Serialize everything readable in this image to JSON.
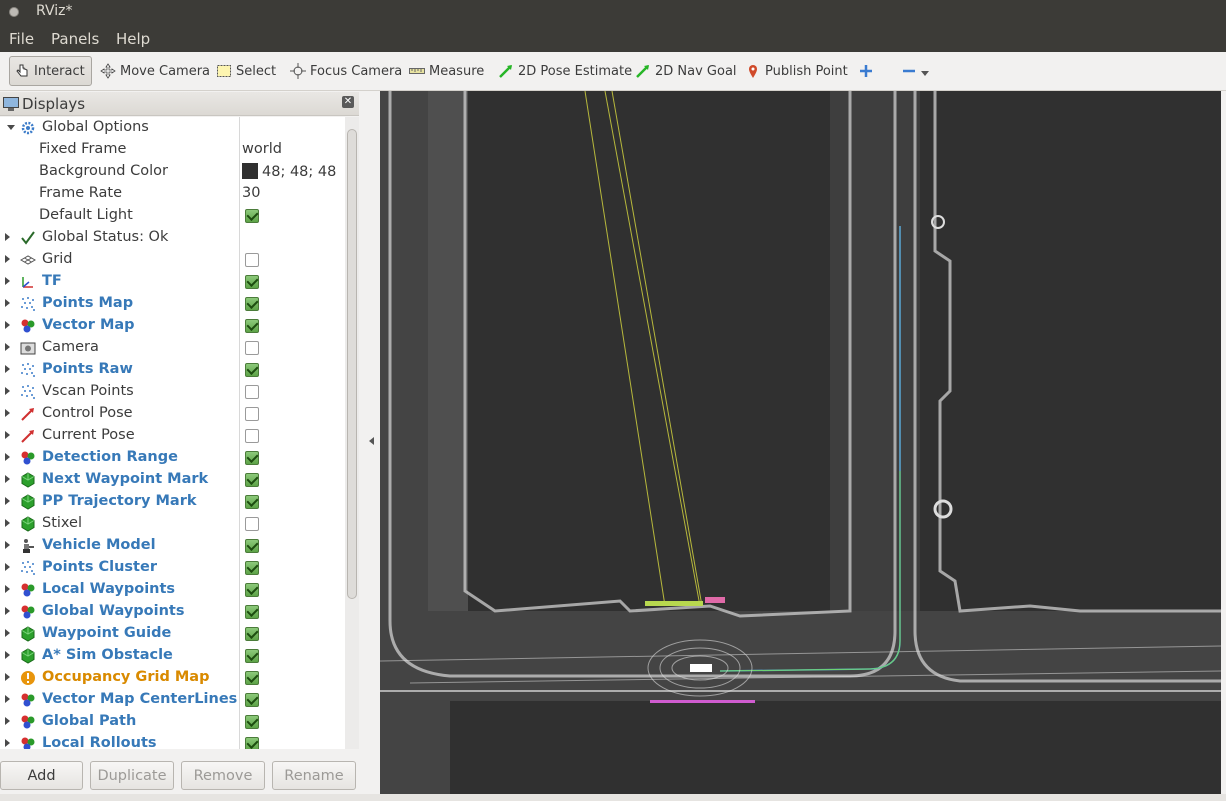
{
  "window": {
    "title": "RViz*"
  },
  "menu": {
    "file": "File",
    "panels": "Panels",
    "help": "Help"
  },
  "toolbar": {
    "interact": "Interact",
    "move_camera": "Move Camera",
    "select": "Select",
    "focus_camera": "Focus Camera",
    "measure": "Measure",
    "pose_estimate": "2D Pose Estimate",
    "nav_goal": "2D Nav Goal",
    "publish_point": "Publish Point"
  },
  "displays_panel": {
    "title": "Displays",
    "global_options": {
      "label": "Global Options",
      "fixed_frame_label": "Fixed Frame",
      "fixed_frame": "world",
      "background_color_label": "Background Color",
      "background_color": "48; 48; 48",
      "background_color_hex": "#303030",
      "frame_rate_label": "Frame Rate",
      "frame_rate": "30",
      "default_light_label": "Default Light",
      "default_light": true
    },
    "global_status": "Global Status: Ok",
    "items": [
      {
        "label": "Grid",
        "enabled": false,
        "icon": "grid-icon",
        "highlight": "normal"
      },
      {
        "label": "TF",
        "enabled": true,
        "icon": "tf-icon",
        "highlight": "bold"
      },
      {
        "label": "Points Map",
        "enabled": true,
        "icon": "pointcloud-icon",
        "highlight": "bold"
      },
      {
        "label": "Vector Map",
        "enabled": true,
        "icon": "marker-array-icon",
        "highlight": "bold"
      },
      {
        "label": "Camera",
        "enabled": false,
        "icon": "camera-icon",
        "highlight": "normal"
      },
      {
        "label": "Points Raw",
        "enabled": true,
        "icon": "pointcloud-icon",
        "highlight": "bold"
      },
      {
        "label": "Vscan Points",
        "enabled": false,
        "icon": "pointcloud-icon",
        "highlight": "normal"
      },
      {
        "label": "Control Pose",
        "enabled": false,
        "icon": "pose-icon",
        "highlight": "normal"
      },
      {
        "label": "Current Pose",
        "enabled": false,
        "icon": "pose-icon",
        "highlight": "normal"
      },
      {
        "label": "Detection Range",
        "enabled": true,
        "icon": "marker-array-icon",
        "highlight": "bold"
      },
      {
        "label": "Next Waypoint Mark",
        "enabled": true,
        "icon": "marker-icon",
        "highlight": "bold"
      },
      {
        "label": "PP Trajectory Mark",
        "enabled": true,
        "icon": "marker-icon",
        "highlight": "bold"
      },
      {
        "label": "Stixel",
        "enabled": false,
        "icon": "marker-icon",
        "highlight": "normal"
      },
      {
        "label": "Vehicle Model",
        "enabled": true,
        "icon": "robot-model-icon",
        "highlight": "bold"
      },
      {
        "label": "Points Cluster",
        "enabled": true,
        "icon": "pointcloud-icon",
        "highlight": "bold"
      },
      {
        "label": "Local Waypoints",
        "enabled": true,
        "icon": "marker-array-icon",
        "highlight": "bold"
      },
      {
        "label": "Global Waypoints",
        "enabled": true,
        "icon": "marker-array-icon",
        "highlight": "bold"
      },
      {
        "label": "Waypoint Guide",
        "enabled": true,
        "icon": "marker-icon",
        "highlight": "bold"
      },
      {
        "label": "A* Sim Obstacle",
        "enabled": true,
        "icon": "marker-icon",
        "highlight": "bold"
      },
      {
        "label": "Occupancy Grid Map",
        "enabled": true,
        "icon": "warning-icon",
        "highlight": "warn"
      },
      {
        "label": "Vector Map CenterLines",
        "enabled": true,
        "icon": "marker-array-icon",
        "highlight": "bold"
      },
      {
        "label": "Global Path",
        "enabled": true,
        "icon": "marker-array-icon",
        "highlight": "bold"
      },
      {
        "label": "Local Rollouts",
        "enabled": true,
        "icon": "marker-array-icon",
        "highlight": "bold"
      }
    ],
    "buttons": {
      "add": "Add",
      "duplicate": "Duplicate",
      "remove": "Remove",
      "rename": "Rename"
    }
  },
  "colors": {
    "bold_item": "#3779b8",
    "warn_item": "#d98a00",
    "title_bar": "#3c3b37",
    "viewport_bg": "#303030"
  }
}
